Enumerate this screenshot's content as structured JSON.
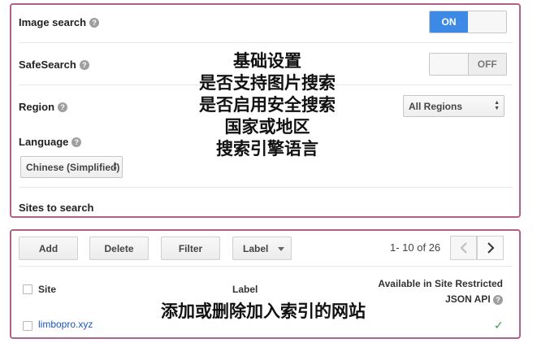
{
  "settings": {
    "image_search": {
      "label": "Image search",
      "on_label": "ON"
    },
    "safesearch": {
      "label": "SafeSearch",
      "off_label": "OFF"
    },
    "region": {
      "label": "Region",
      "selected": "All Regions"
    },
    "language": {
      "label": "Language",
      "selected": "Chinese (Simplified)"
    },
    "sites_to_search": {
      "label": "Sites to search"
    },
    "help_glyph": "?"
  },
  "annotation_top": [
    "基础设置",
    "是否支持图片搜索",
    "是否启用安全搜索",
    "国家或地区",
    "搜索引擎语言"
  ],
  "toolbar": {
    "add": "Add",
    "delete": "Delete",
    "filter": "Filter",
    "label": "Label",
    "pager_text": "1- 10 of 26"
  },
  "table": {
    "headers": {
      "site": "Site",
      "label": "Label",
      "api_line1": "Available in Site Restricted",
      "api_line2": "JSON API"
    },
    "rows": [
      {
        "site": "limbopro.xyz",
        "label": "",
        "available": true
      }
    ]
  },
  "annotation_bottom": "添加或删除加入索引的网站",
  "colors": {
    "accent_blue": "#3d8ae6",
    "frame": "#b25f8a",
    "link": "#1a55c4",
    "check": "#2e9e4d"
  }
}
